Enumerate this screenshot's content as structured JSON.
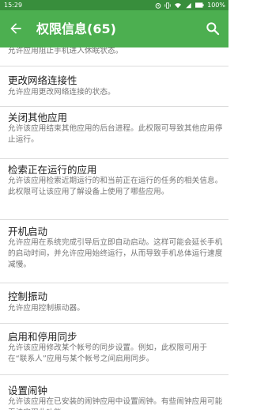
{
  "status_bar": {
    "time": "15:29",
    "battery": "100%"
  },
  "app_bar": {
    "title": "权限信息(65)"
  },
  "items": [
    {
      "title": "",
      "desc": "允许应用阻止手机进入休眠状态。"
    },
    {
      "title": "更改网络连接性",
      "desc": "允许应用更改网络连接的状态。"
    },
    {
      "title": "关闭其他应用",
      "desc": "允许该应用结束其他应用的后台进程。此权限可导致其他应用停止运行。"
    },
    {
      "title": "检索正在运行的应用",
      "desc": "允许该应用检索近期运行的和当前正在运行的任务的相关信息。此权限可让该应用了解设备上使用了哪些应用。"
    },
    {
      "title": "开机启动",
      "desc": "允许应用在系统完成引导后立即自动启动。这样可能会延长手机的启动时间，并允许应用始终运行，从而导致手机总体运行速度减慢。"
    },
    {
      "title": "控制振动",
      "desc": "允许应用控制振动器。"
    },
    {
      "title": "启用和停用同步",
      "desc": "允许该应用修改某个帐号的同步设置。例如，此权限可用于在“联系人”应用与某个帐号之间启用同步。"
    },
    {
      "title": "设置闹钟",
      "desc": "允许该应用在已安装的闹钟应用中设置闹钟。有些闹钟应用可能无法实现此功能。"
    }
  ]
}
